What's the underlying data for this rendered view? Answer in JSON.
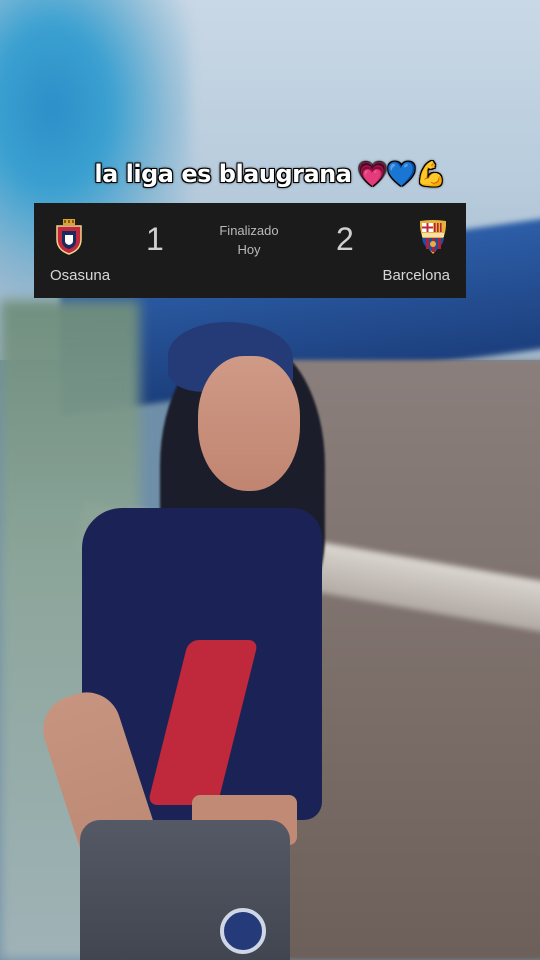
{
  "caption": {
    "text": "la liga es blaugrana",
    "emojis": "💗💙💪"
  },
  "match": {
    "home_team": "Osasuna",
    "home_score": "1",
    "away_team": "Barcelona",
    "away_score": "2",
    "status": "Finalizado",
    "date": "Hoy"
  },
  "colors": {
    "card_background": "#1b1b1b",
    "osasuna_red": "#c0283c",
    "barcelona_blue": "#1f4fa0",
    "barcelona_red": "#b51f3a"
  },
  "icons": {
    "home_crest": "osasuna-crest-icon",
    "away_crest": "barcelona-crest-icon"
  }
}
